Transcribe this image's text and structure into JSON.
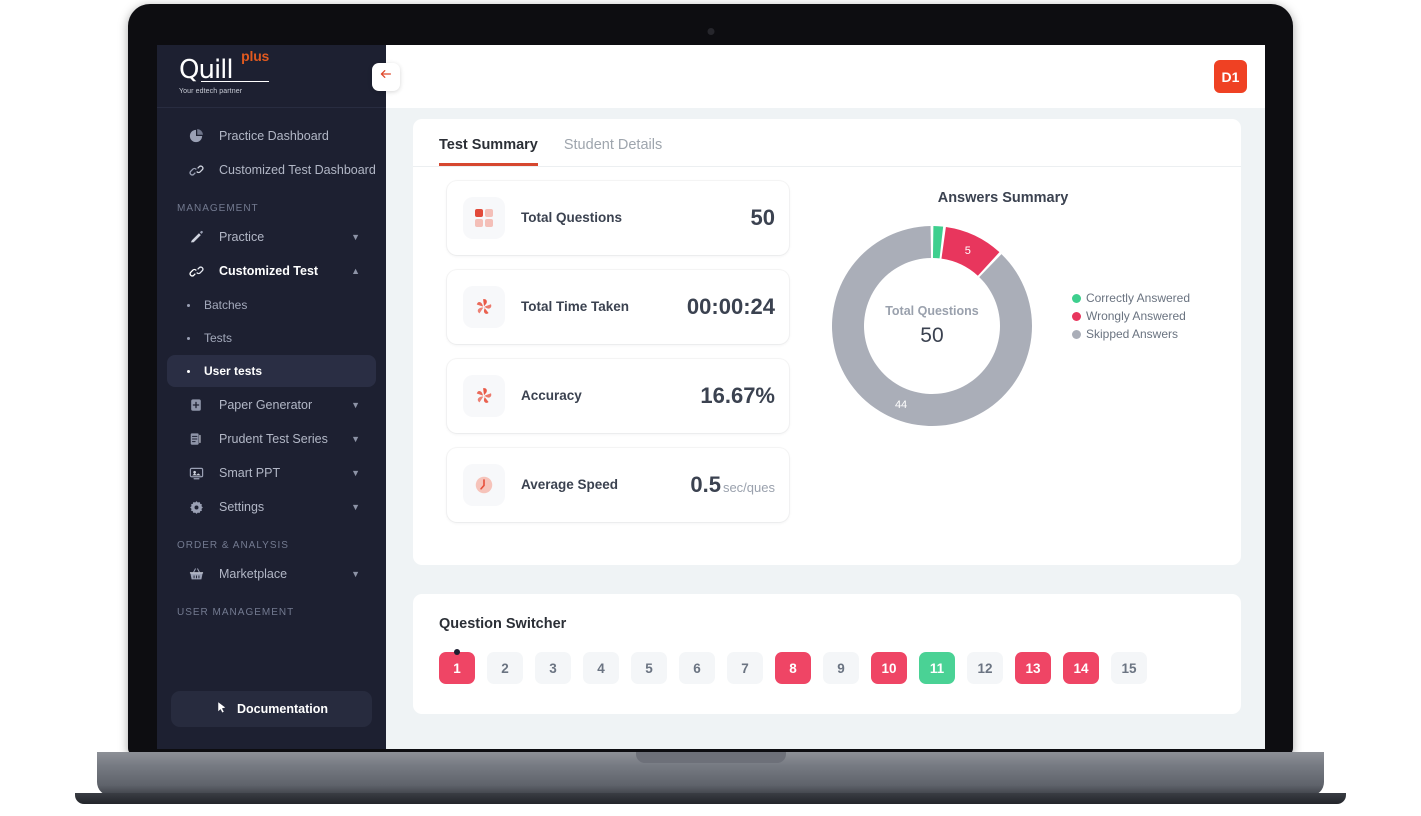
{
  "device": {
    "label": "MacBook Air"
  },
  "sidebar": {
    "logo": {
      "main": "Quill",
      "plus": "plus",
      "tagline": "Your edtech partner"
    },
    "top_items": [
      {
        "label": "Practice Dashboard",
        "icon": "pie-chart-icon"
      },
      {
        "label": "Customized Test Dashboard",
        "icon": "link-icon"
      }
    ],
    "sections": [
      {
        "title": "MANAGEMENT",
        "items": [
          {
            "label": "Practice",
            "icon": "pencil-icon",
            "chevron": "down",
            "expanded": false
          },
          {
            "label": "Customized Test",
            "icon": "link-icon",
            "chevron": "up",
            "expanded": true,
            "active": true,
            "children": [
              {
                "label": "Batches",
                "active": false
              },
              {
                "label": "Tests",
                "active": false
              },
              {
                "label": "User tests",
                "active": true
              }
            ]
          },
          {
            "label": "Paper Generator",
            "icon": "document-plus-icon",
            "chevron": "down",
            "expanded": false
          },
          {
            "label": "Prudent Test Series",
            "icon": "list-icon",
            "chevron": "down",
            "expanded": false
          },
          {
            "label": "Smart PPT",
            "icon": "presentation-icon",
            "chevron": "down",
            "expanded": false
          },
          {
            "label": "Settings",
            "icon": "gear-icon",
            "chevron": "down",
            "expanded": false
          }
        ]
      },
      {
        "title": "ORDER & ANALYSIS",
        "items": [
          {
            "label": "Marketplace",
            "icon": "basket-icon",
            "chevron": "down",
            "expanded": false
          }
        ]
      },
      {
        "title": "USER MANAGEMENT",
        "items": []
      }
    ],
    "documentation_button": {
      "label": "Documentation",
      "icon": "cursor-icon"
    }
  },
  "topbar": {
    "back_icon": "arrow-left-icon",
    "avatar_initials": "D1"
  },
  "tabs": [
    {
      "label": "Test Summary",
      "active": true
    },
    {
      "label": "Student Details",
      "active": false
    }
  ],
  "stats": [
    {
      "icon": "grid-squares-icon",
      "label": "Total Questions",
      "value": "50",
      "unit": ""
    },
    {
      "icon": "pinwheel-icon",
      "label": "Total Time Taken",
      "value": "00:00:24",
      "unit": ""
    },
    {
      "icon": "pinwheel-icon",
      "label": "Accuracy",
      "value": "16.67%",
      "unit": ""
    },
    {
      "icon": "clock-icon",
      "label": "Average Speed",
      "value": "0.5",
      "unit": "sec/ques"
    }
  ],
  "chart_data": {
    "type": "pie",
    "title": "Answers Summary",
    "center_label": "Total Questions",
    "center_value": "50",
    "total": 50,
    "categories": [
      "Correctly Answered",
      "Wrongly Answered",
      "Skipped Answers"
    ],
    "values": [
      1,
      5,
      44
    ],
    "colors": [
      "#3ecf8e",
      "#e8365d",
      "#aaaeb8"
    ],
    "slice_labels": [
      "",
      "5",
      "44"
    ],
    "legend_position": "right",
    "xlabel": "",
    "ylabel": ""
  },
  "question_switcher": {
    "title": "Question Switcher",
    "buttons": [
      {
        "n": "1",
        "state": "wrong",
        "current": true
      },
      {
        "n": "2",
        "state": "skipped",
        "current": false
      },
      {
        "n": "3",
        "state": "skipped",
        "current": false
      },
      {
        "n": "4",
        "state": "skipped",
        "current": false
      },
      {
        "n": "5",
        "state": "skipped",
        "current": false
      },
      {
        "n": "6",
        "state": "skipped",
        "current": false
      },
      {
        "n": "7",
        "state": "skipped",
        "current": false
      },
      {
        "n": "8",
        "state": "wrong",
        "current": false
      },
      {
        "n": "9",
        "state": "skipped",
        "current": false
      },
      {
        "n": "10",
        "state": "wrong",
        "current": false
      },
      {
        "n": "11",
        "state": "correct",
        "current": false
      },
      {
        "n": "12",
        "state": "skipped",
        "current": false
      },
      {
        "n": "13",
        "state": "wrong",
        "current": false
      },
      {
        "n": "14",
        "state": "wrong",
        "current": false
      },
      {
        "n": "15",
        "state": "skipped",
        "current": false
      }
    ]
  },
  "colors": {
    "brand_orange": "#e0591f",
    "avatar_red": "#ef4123",
    "tab_underline": "#d6472f",
    "correct_green": "#4ad295",
    "wrong_pink": "#ef4565",
    "skipped_gray": "#aaaeb8",
    "sidebar_bg": "#1d2031"
  }
}
